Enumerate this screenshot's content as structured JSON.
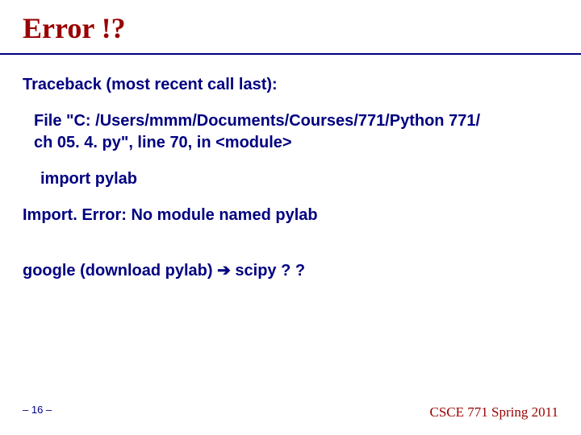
{
  "title": "Error  !?",
  "body": {
    "traceback_header": "Traceback (most recent call last):",
    "file_line1": "File \"C: /Users/mmm/Documents/Courses/771/Python 771/",
    "file_line2": "ch 05. 4. py\", line 70, in <module>",
    "import_line": "import pylab",
    "import_error": "Import. Error: No module named pylab",
    "google_prefix": "google (download pylab) ",
    "arrow": "➔",
    "google_suffix": " scipy ? ?"
  },
  "footer": {
    "page": "– 16 –",
    "course": "CSCE 771 Spring 2011"
  }
}
